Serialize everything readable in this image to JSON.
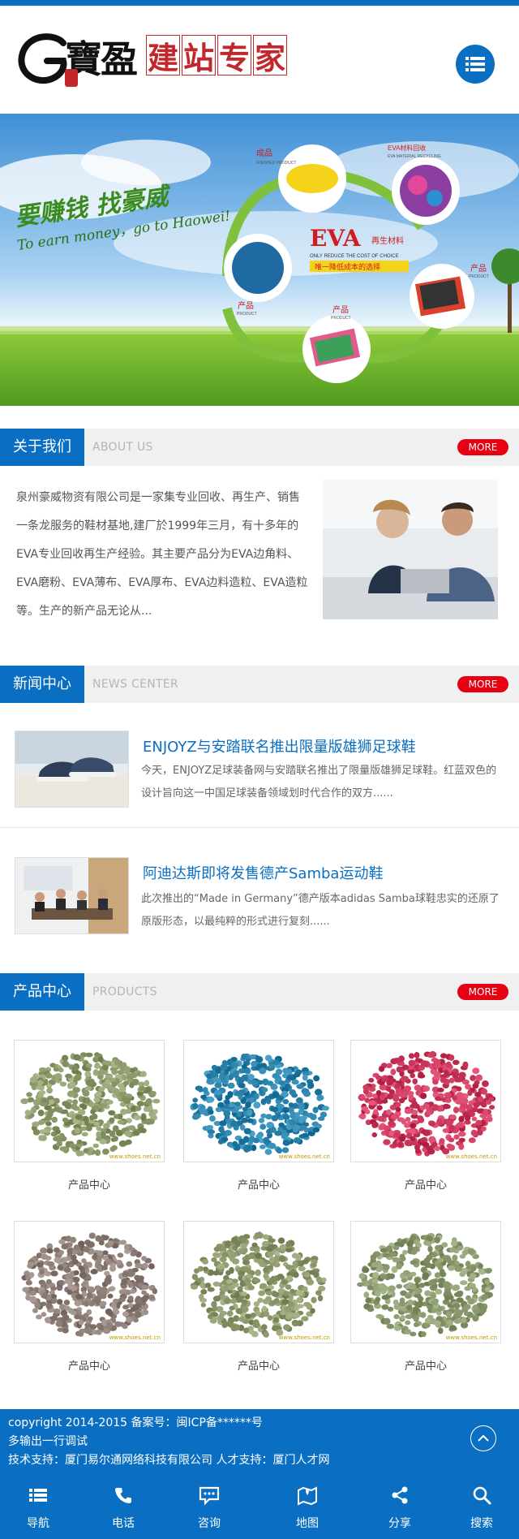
{
  "header": {
    "logo_brand": "寶盈",
    "logo_slogan": [
      "建",
      "站",
      "专",
      "家"
    ],
    "menu_icon": "list-menu-icon"
  },
  "banner": {
    "slogan_cn": "要赚钱 找豪威",
    "slogan_en": "To earn money，go to Haowei!",
    "eva_title": "EVA",
    "eva_sub": "再生材料",
    "eva_en": "ONLY REDUCE THE COST OF CHOICE",
    "eva_tag": "唯一降低成本的选择",
    "labels": {
      "finished": "成品",
      "finished_en": "FINISHED PRODUCT",
      "recycle": "EVA材料回收",
      "recycle_en": "EVA MATERIAL RECYCLING",
      "product1": "产品",
      "product1_en": "PRODUCT",
      "product2": "产品",
      "product2_en": "PRODUCT",
      "product3": "产品",
      "product3_en": "PRODUCT"
    }
  },
  "about": {
    "title": "关于我们",
    "title_en": "ABOUT US",
    "more": "MORE",
    "text": "泉州豪威物资有限公司是一家集专业回收、再生产、销售一条龙服务的鞋材基地,建厂於1999年三月，有十多年的EVA专业回收再生产经验。其主要产品分为EVA边角料、EVA磨粉、EVA薄布、EVA厚布、EVA边料造粒、EVA造粒等。生产的新产品无论从..."
  },
  "news": {
    "title": "新闻中心",
    "title_en": "NEWS CENTER",
    "more": "MORE",
    "items": [
      {
        "title": " ENJOYZ与安踏联名推出限量版雄狮足球鞋",
        "desc": "今天，ENJOYZ足球装备网与安踏联名推出了限量版雄狮足球鞋。红蓝双色的设计旨向这一中国足球装备领域划时代合作的双方......"
      },
      {
        "title": "阿迪达斯即将发售德产Samba运动鞋",
        "desc": "此次推出的“Made in Germany”德产版本adidas Samba球鞋忠实的还原了原版形态，以最纯粹的形式进行复刻......"
      }
    ]
  },
  "products": {
    "title": "产品中心",
    "title_en": "PRODUCTS",
    "more": "MORE",
    "watermark": "www.shoes.net.cn",
    "items": [
      {
        "label": "产品中心",
        "color": "#8c9a6b"
      },
      {
        "label": "产品中心",
        "color": "#2c84ad"
      },
      {
        "label": "产品中心",
        "color": "#cc3a5f"
      },
      {
        "label": "产品中心",
        "color": "#8d7f78"
      },
      {
        "label": "产品中心",
        "color": "#8e9a6e"
      },
      {
        "label": "产品中心",
        "color": "#8a9a6e"
      }
    ]
  },
  "footer": {
    "line1": "copyright 2014-2015 备案号：闽ICP备******号",
    "line2": "多输出一行调试",
    "line3": "技术支持：厦门易尔通网络科技有限公司 人才支持：厦门人才网",
    "top_icon": "chevron-up-icon"
  },
  "bottom_nav": [
    {
      "label": "导航",
      "icon": "list-menu-icon"
    },
    {
      "label": "电话",
      "icon": "phone-icon"
    },
    {
      "label": "咨询",
      "icon": "chat-icon"
    },
    {
      "label": "地图",
      "icon": "map-icon"
    },
    {
      "label": "分享",
      "icon": "share-icon"
    },
    {
      "label": "搜索",
      "icon": "search-icon"
    }
  ],
  "colors": {
    "brand_blue": "#0a6fc2",
    "more_red": "#e60012",
    "logo_red": "#c0282d"
  }
}
